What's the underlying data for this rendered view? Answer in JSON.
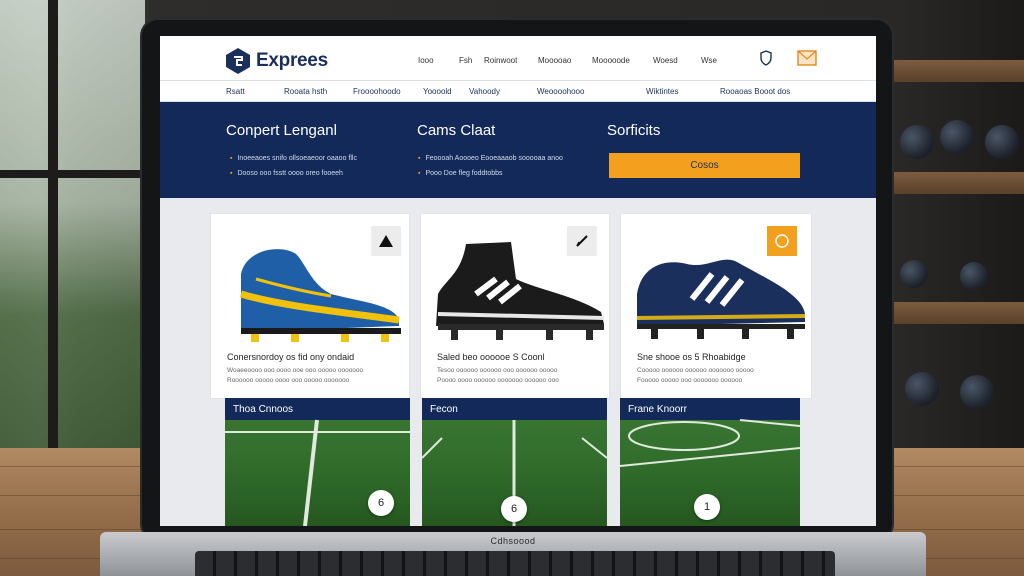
{
  "brand": {
    "name": "Exprees",
    "color": "#1b2f5c"
  },
  "top_nav": [
    "Iooo",
    "Fsh",
    "Roinwoot",
    "Mooooao",
    "Mooooode",
    "Woesd",
    "Wse"
  ],
  "top_icons": [
    "shield-icon",
    "mail-icon"
  ],
  "sub_nav": [
    "Rsatt",
    "Rooata hsth",
    "Froooohoodo",
    "Yoooold",
    "Vahoody",
    "Weoooohooo",
    "Wiktintes",
    "Rooaoas Booot dos"
  ],
  "hero": {
    "columns": [
      {
        "title": "Conpert Lenganl",
        "bullets": [
          "Inoeeaoes snifo ollsoeaeoor oaaoo fllc",
          "Dooso ooo fsstt oooo oreo fooeeh"
        ]
      },
      {
        "title": "Cams Claat",
        "bullets": [
          "Feoooah Aoooeo Eooeaaaob sooooaa anoo",
          "Pooo Doe fleg foddtobbs"
        ]
      },
      {
        "title": "Sorficits",
        "cta_label": "Cosos"
      }
    ],
    "accent": "#f3a01f",
    "bg": "#13295a"
  },
  "products": [
    {
      "title": "Conersnordoy os fid ony ondaid",
      "desc": [
        "Woaeeoooo ooo oooo ooe ooo ooooo ooooooo",
        "Roooooo ooooo oooo ooo ooooo ooooooo"
      ],
      "badge_icon": "warning-triangle-icon"
    },
    {
      "title": "Saled beo oooooe S Coonl",
      "desc": [
        "Tesoo oooooo oooooo ooo oooooo ooooo",
        "Poooo oooo oooooo ooooooo oooooo ooo"
      ],
      "badge_icon": "pen-icon"
    },
    {
      "title": "Sne shooe os 5 Rhoabidge",
      "desc": [
        "Cooooo oooooo oooooo ooooooo ooooo",
        "Fooooo ooooo ooo ooooooo oooooo"
      ],
      "badge_icon": "ball-icon"
    }
  ],
  "fields": [
    {
      "label": "Thoa Cnnoos",
      "marker": "6"
    },
    {
      "label": "Fecon",
      "marker": "6"
    },
    {
      "label": "Frane Knoorr",
      "marker": "1"
    }
  ],
  "laptop_brand": "Cdhsoood"
}
